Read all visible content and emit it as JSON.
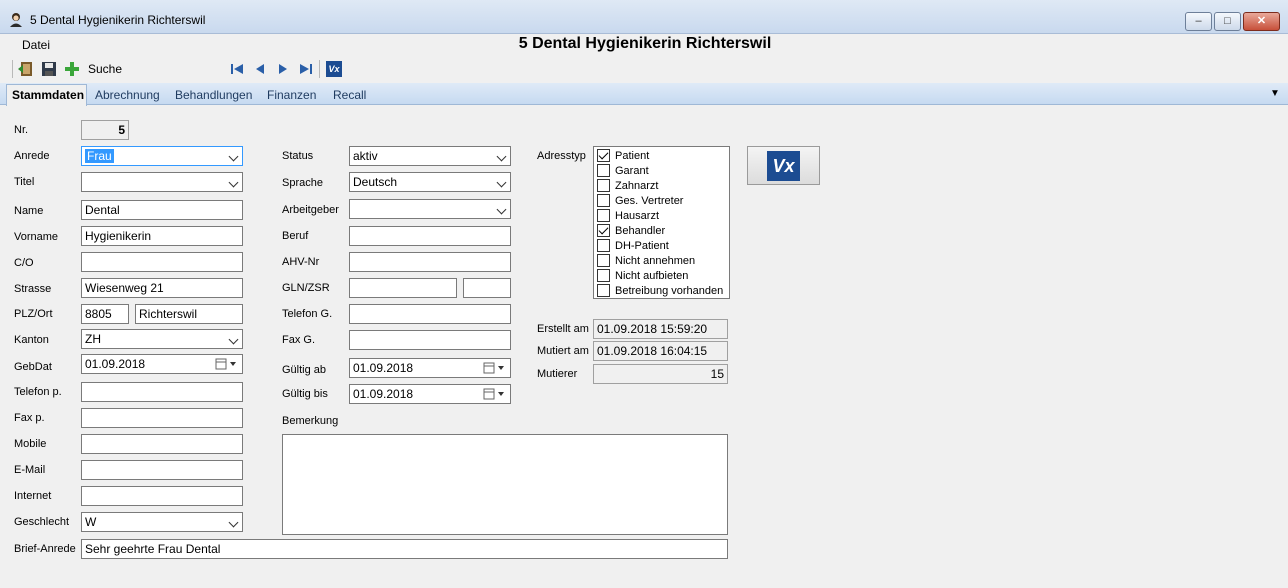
{
  "window": {
    "title": "5 Dental Hygienikerin Richterswil",
    "minimize_glyph": "–",
    "maximize_glyph": "□",
    "close_glyph": "✕"
  },
  "menu": {
    "datei": "Datei"
  },
  "header": {
    "title": "5 Dental Hygienikerin Richterswil"
  },
  "toolbar": {
    "search_label": "Suche",
    "icons": [
      "exit-icon",
      "save-icon",
      "add-icon",
      "first-record-icon",
      "previous-record-icon",
      "next-record-icon",
      "last-record-icon",
      "vx-icon"
    ],
    "vx_label": "Vx"
  },
  "tabs": [
    "Stammdaten",
    "Abrechnung",
    "Behandlungen",
    "Finanzen",
    "Recall"
  ],
  "tab_menu_glyph": "▼",
  "left": {
    "nr": {
      "label": "Nr.",
      "value": "5"
    },
    "anrede": {
      "label": "Anrede",
      "value": "Frau"
    },
    "titel": {
      "label": "Titel",
      "value": ""
    },
    "name": {
      "label": "Name",
      "value": "Dental"
    },
    "vorname": {
      "label": "Vorname",
      "value": "Hygienikerin"
    },
    "co": {
      "label": "C/O",
      "value": ""
    },
    "strasse": {
      "label": "Strasse",
      "value": "Wiesenweg 21"
    },
    "plzort": {
      "label": "PLZ/Ort",
      "plz": "8805",
      "ort": "Richterswil"
    },
    "kanton": {
      "label": "Kanton",
      "value": "ZH"
    },
    "gebdat": {
      "label": "GebDat",
      "value": "01.09.2018"
    },
    "telefon_p": {
      "label": "Telefon p.",
      "value": ""
    },
    "fax_p": {
      "label": "Fax p.",
      "value": ""
    },
    "mobile": {
      "label": "Mobile",
      "value": ""
    },
    "email": {
      "label": "E-Mail",
      "value": ""
    },
    "internet": {
      "label": "Internet",
      "value": ""
    },
    "geschlecht": {
      "label": "Geschlecht",
      "value": "W"
    },
    "brief_anrede": {
      "label": "Brief-Anrede",
      "value": "Sehr geehrte Frau Dental"
    }
  },
  "middle": {
    "status": {
      "label": "Status",
      "value": "aktiv"
    },
    "sprache": {
      "label": "Sprache",
      "value": "Deutsch"
    },
    "arbeitgeber": {
      "label": "Arbeitgeber",
      "value": ""
    },
    "beruf": {
      "label": "Beruf",
      "value": ""
    },
    "ahv": {
      "label": "AHV-Nr",
      "value": ""
    },
    "gln": {
      "label": "GLN/ZSR",
      "gln": "",
      "zsr": ""
    },
    "telefon_g": {
      "label": "Telefon G.",
      "value": ""
    },
    "fax_g": {
      "label": "Fax G.",
      "value": ""
    },
    "gueltig_ab": {
      "label": "Gültig ab",
      "value": "01.09.2018"
    },
    "gueltig_bis": {
      "label": "Gültig bis",
      "value": "01.09.2018"
    },
    "bemerkung": {
      "label": "Bemerkung",
      "value": ""
    }
  },
  "right": {
    "adresstyp_label": "Adresstyp",
    "adresstyp": [
      {
        "label": "Patient",
        "checked": true
      },
      {
        "label": "Garant",
        "checked": false
      },
      {
        "label": "Zahnarzt",
        "checked": false
      },
      {
        "label": "Ges. Vertreter",
        "checked": false
      },
      {
        "label": "Hausarzt",
        "checked": false
      },
      {
        "label": "Behandler",
        "checked": true
      },
      {
        "label": "DH-Patient",
        "checked": false
      },
      {
        "label": "Nicht annehmen",
        "checked": false
      },
      {
        "label": "Nicht aufbieten",
        "checked": false
      },
      {
        "label": "Betreibung vorhanden",
        "checked": false
      }
    ],
    "erstellt": {
      "label": "Erstellt am",
      "value": "01.09.2018 15:59:20"
    },
    "mutiert": {
      "label": "Mutiert am",
      "value": "01.09.2018 16:04:15"
    },
    "mutierer": {
      "label": "Mutierer",
      "value": "15"
    },
    "vx_label": "Vx"
  }
}
